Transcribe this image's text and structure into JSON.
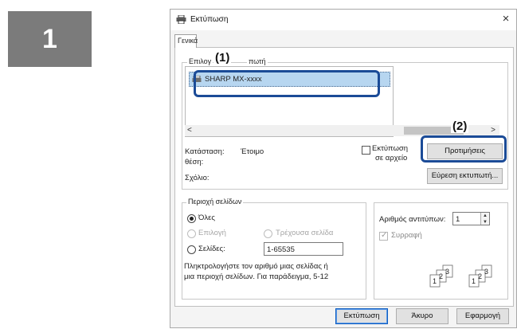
{
  "step_number": "1",
  "dialog": {
    "title": "Εκτύπωση",
    "close_glyph": "×"
  },
  "tabs": [
    {
      "label": "Γενικά",
      "active": true
    }
  ],
  "select_printer": {
    "group_label_part1": "Επιλογ",
    "group_label_part2": "πωτή",
    "printers": [
      {
        "name": "SHARP MX-xxxx",
        "selected": true
      }
    ],
    "scroll_left_glyph": "<",
    "scroll_right_glyph": ">"
  },
  "status": {
    "status_label": "Κατάσταση:",
    "status_value": "Έτοιμο",
    "location_label": "θέση:",
    "comment_label": "Σχόλιο:"
  },
  "print_to_file": {
    "line1": "Εκτύπωση",
    "line2": "σε αρχείο",
    "checked": false
  },
  "buttons": {
    "preferences": "Προτιμήσεις",
    "find_printer": "Εύρεση εκτυπωτή...",
    "print": "Εκτύπωση",
    "cancel": "Άκυρο",
    "apply": "Εφαρμογή"
  },
  "page_range": {
    "group_label": "Περιοχή σελίδων",
    "all_label": "Όλες",
    "selection_label": "Επιλογή",
    "current_page_label": "Τρέχουσα σελίδα",
    "pages_label": "Σελίδες:",
    "pages_value": "1-65535",
    "help_line1": "Πληκτρολογήστε τον αριθμό μιας σελίδας ή",
    "help_line2": "μια περιοχή σελίδων. Για παράδειγμα, 5-12",
    "selected_option": "all"
  },
  "copies": {
    "count_label": "Αριθμός αντιτύπων:",
    "count_value": "1",
    "collate_label": "Συρραφή",
    "collate_checked": true,
    "collate_set_a": [
      "1",
      "2",
      "3"
    ],
    "collate_set_b": [
      "1",
      "2",
      "3"
    ]
  },
  "callouts": {
    "first": "(1)",
    "second": "(2)",
    "color": "#1b4b97"
  },
  "icons": [
    "printer-icon",
    "close-icon",
    "scroll-left-icon",
    "scroll-right-icon",
    "spin-icon",
    "collate-icon"
  ]
}
